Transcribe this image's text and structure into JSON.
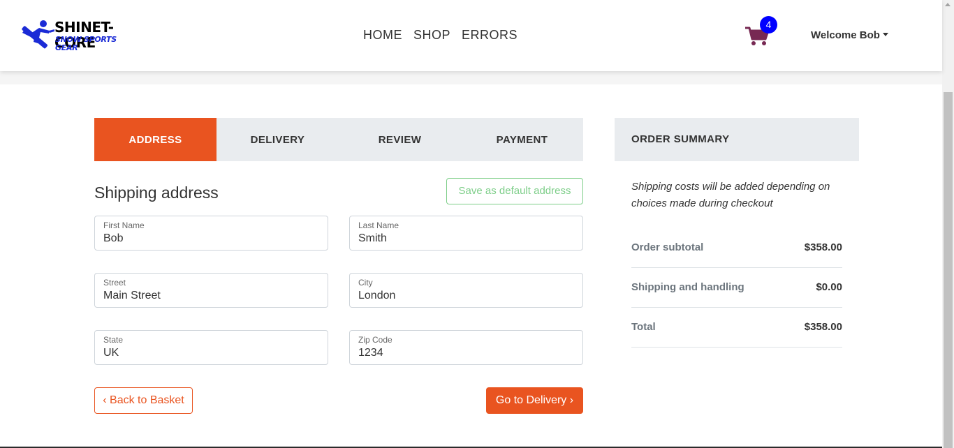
{
  "header": {
    "logo_title": "SHINET-CORE",
    "logo_subtitle": "SNOW SPORTS GEAR",
    "nav": [
      "HOME",
      "SHOP",
      "ERRORS"
    ],
    "cart_count": "4",
    "welcome": "Welcome Bob"
  },
  "steps": {
    "tabs": [
      "ADDRESS",
      "DELIVERY",
      "REVIEW",
      "PAYMENT"
    ],
    "active": "ADDRESS"
  },
  "form": {
    "title": "Shipping address",
    "save_default_label": "Save as default address",
    "fields": [
      {
        "label": "First Name",
        "value": "Bob"
      },
      {
        "label": "Last Name",
        "value": "Smith"
      },
      {
        "label": "Street",
        "value": "Main Street"
      },
      {
        "label": "City",
        "value": "London"
      },
      {
        "label": "State",
        "value": "UK"
      },
      {
        "label": "Zip Code",
        "value": "1234"
      }
    ],
    "back_label": "Back to Basket",
    "next_label": "Go to Delivery"
  },
  "summary": {
    "title": "ORDER SUMMARY",
    "note": "Shipping costs will be added depending on choices made during checkout",
    "rows": [
      {
        "label": "Order subtotal",
        "value": "$358.00"
      },
      {
        "label": "Shipping and handling",
        "value": "$0.00"
      },
      {
        "label": "Total",
        "value": "$358.00"
      }
    ]
  },
  "colors": {
    "accent": "#e95420",
    "success": "#38b44a",
    "badge": "#0000ff",
    "tab_bg": "#e9ecef",
    "cart": "#772953"
  },
  "icons": [
    "snowboarder-logo-icon",
    "cart-icon",
    "chevron-left-icon",
    "chevron-right-icon",
    "caret-down-icon"
  ]
}
